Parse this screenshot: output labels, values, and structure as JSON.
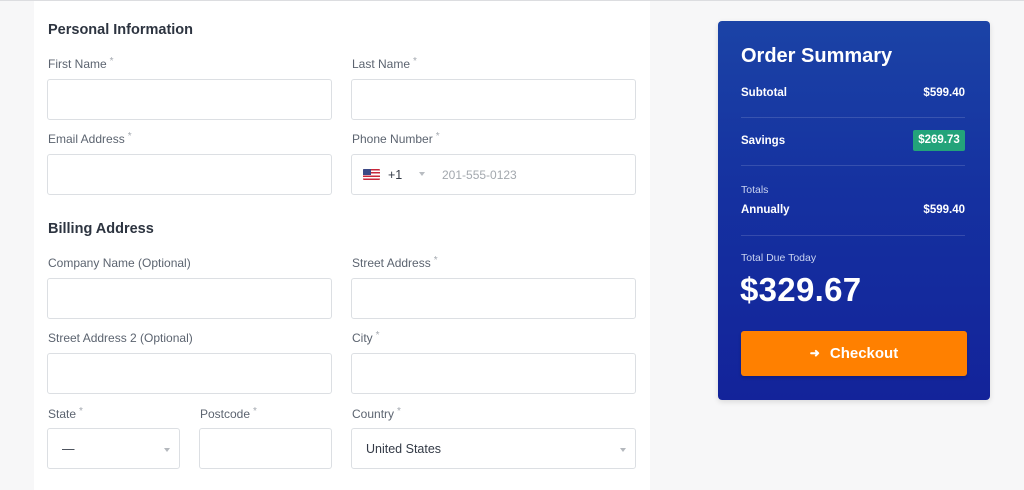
{
  "personal": {
    "title": "Personal Information",
    "first_name_label": "First Name",
    "last_name_label": "Last Name",
    "email_label": "Email Address",
    "phone_label": "Phone Number",
    "required_mark": "*",
    "first_name_value": "",
    "last_name_value": "",
    "email_value": "",
    "phone_country_flag": "us-flag-icon",
    "phone_dial_code": "+1",
    "phone_placeholder": "201-555-0123",
    "phone_value": ""
  },
  "billing": {
    "title": "Billing Address",
    "company_label": "Company Name (Optional)",
    "street_label": "Street Address",
    "street2_label": "Street Address 2 (Optional)",
    "city_label": "City",
    "state_label": "State",
    "postcode_label": "Postcode",
    "country_label": "Country",
    "company_value": "",
    "street_value": "",
    "street2_value": "",
    "city_value": "",
    "state_selected": "—",
    "postcode_value": "",
    "country_selected": "United States"
  },
  "summary": {
    "title": "Order Summary",
    "subtotal_label": "Subtotal",
    "subtotal_value": "$599.40",
    "savings_label": "Savings",
    "savings_value": "$269.73",
    "totals_label": "Totals",
    "annually_label": "Annually",
    "annually_value": "$599.40",
    "due_today_label": "Total Due Today",
    "due_today_value": "$329.67",
    "checkout_label": "Checkout",
    "checkout_icon": "arrow-right-icon"
  },
  "colors": {
    "summary_bg": "#1b3aa3",
    "checkout_bg": "#ff8000",
    "savings_badge": "#23a37a"
  }
}
